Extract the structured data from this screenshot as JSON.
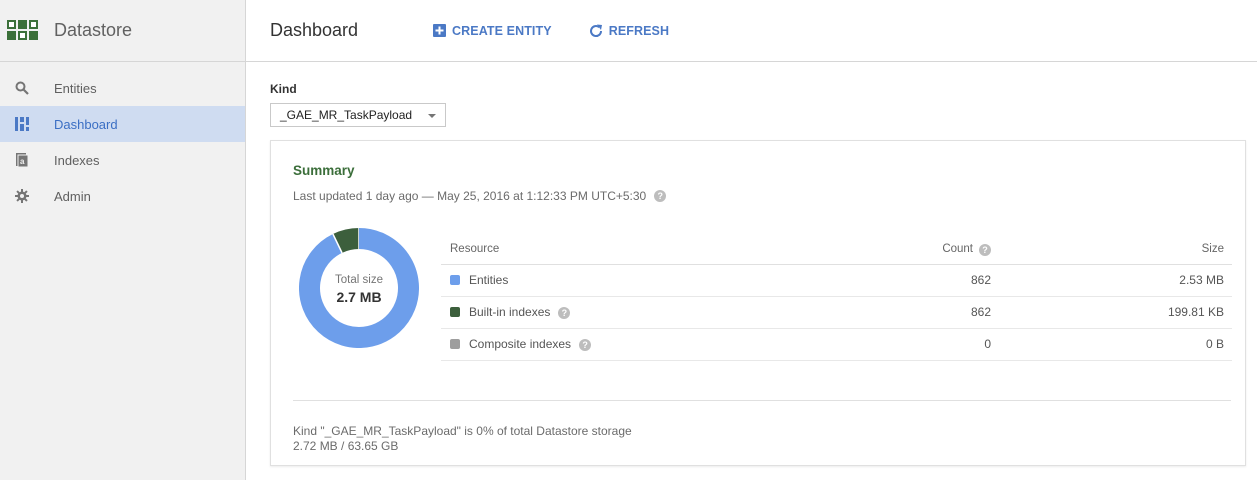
{
  "sidebar": {
    "title": "Datastore",
    "items": [
      {
        "label": "Entities",
        "icon": "search-icon",
        "active": false
      },
      {
        "label": "Dashboard",
        "icon": "dashboard-icon",
        "active": true
      },
      {
        "label": "Indexes",
        "icon": "indexes-icon",
        "active": false
      },
      {
        "label": "Admin",
        "icon": "gear-icon",
        "active": false
      }
    ]
  },
  "header": {
    "title": "Dashboard",
    "create_label": "CREATE ENTITY",
    "refresh_label": "REFRESH"
  },
  "kind": {
    "label": "Kind",
    "selected": "_GAE_MR_TaskPayload"
  },
  "summary": {
    "title": "Summary",
    "last_updated": "Last updated 1 day ago — May 25, 2016 at 1:12:33 PM UTC+5:30",
    "total_label": "Total size",
    "total_value": "2.7 MB",
    "columns": {
      "resource": "Resource",
      "count": "Count",
      "size": "Size"
    },
    "rows": [
      {
        "resource": "Entities",
        "count": "862",
        "size": "2.53 MB",
        "color": "#6d9eeb"
      },
      {
        "resource": "Built-in indexes",
        "count": "862",
        "size": "199.81 KB",
        "color": "#3c5f3c"
      },
      {
        "resource": "Composite indexes",
        "count": "0",
        "size": "0 B",
        "color": "#9e9e9e"
      }
    ],
    "footnote_line1": "Kind \"_GAE_MR_TaskPayload\" is 0% of total Datastore storage",
    "footnote_line2": "2.72 MB / 63.65 GB"
  },
  "colors": {
    "accent": "#4b79c5",
    "entities": "#6d9eeb",
    "builtin": "#3c5f3c",
    "composite": "#9e9e9e"
  }
}
